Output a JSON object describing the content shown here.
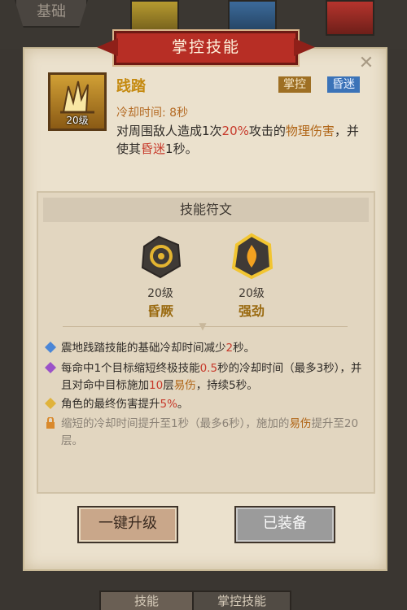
{
  "background": {
    "basic_tab_label": "基础"
  },
  "dialog": {
    "title": "掌控技能",
    "close_icon": "close-icon",
    "skill": {
      "name": "践踏",
      "level": "20级",
      "tags": [
        "掌控",
        "昏迷"
      ],
      "cooldown": "冷却时间: 8秒",
      "description_parts": [
        {
          "text": "对周围敌人造成1次",
          "style": "normal"
        },
        {
          "text": "20%",
          "style": "red"
        },
        {
          "text": "攻击的",
          "style": "normal"
        },
        {
          "text": "物理伤害",
          "style": "orange"
        },
        {
          "text": "，并使其",
          "style": "normal"
        },
        {
          "text": "昏迷",
          "style": "red"
        },
        {
          "text": "1秒。",
          "style": "normal"
        }
      ]
    },
    "runes_section": {
      "title": "技能符文",
      "runes": [
        {
          "level": "20级",
          "name": "昏厥",
          "icon": "stun-swirl-icon"
        },
        {
          "level": "20级",
          "name": "强劲",
          "icon": "flame-icon"
        }
      ],
      "effects": [
        {
          "icon": "blue-diamond-icon",
          "parts": [
            {
              "text": "震地践踏技能的基础冷却时间减少",
              "style": "normal"
            },
            {
              "text": "2",
              "style": "red"
            },
            {
              "text": "秒。",
              "style": "normal"
            }
          ]
        },
        {
          "icon": "purple-diamond-icon",
          "parts": [
            {
              "text": "每命中1个目标缩短终极技能",
              "style": "normal"
            },
            {
              "text": "0.5",
              "style": "red"
            },
            {
              "text": "秒的冷却时间（最多3秒），并且对命中目标施加",
              "style": "normal"
            },
            {
              "text": "10",
              "style": "red"
            },
            {
              "text": "层",
              "style": "normal"
            },
            {
              "text": "易伤",
              "style": "orange"
            },
            {
              "text": "，持续5秒。",
              "style": "normal"
            }
          ]
        },
        {
          "icon": "gold-diamond-icon",
          "parts": [
            {
              "text": "角色的最终伤害提升",
              "style": "normal"
            },
            {
              "text": "5%",
              "style": "red"
            },
            {
              "text": "。",
              "style": "normal"
            }
          ]
        },
        {
          "icon": "lock-icon",
          "locked": true,
          "parts": [
            {
              "text": "缩短的冷却时间提升至1秒（最多6秒），施加的",
              "style": "normal"
            },
            {
              "text": "易伤",
              "style": "orange"
            },
            {
              "text": "提升至20层。",
              "style": "normal"
            }
          ]
        }
      ]
    },
    "buttons": {
      "upgrade": "一键升级",
      "equipped": "已装备"
    }
  },
  "bottom_tabs": [
    "技能",
    "掌控技能"
  ],
  "colors": {
    "accent_red": "#c73a2b",
    "accent_orange": "#b06516",
    "banner": "#b72e25",
    "parchment": "#ebe1cd"
  }
}
